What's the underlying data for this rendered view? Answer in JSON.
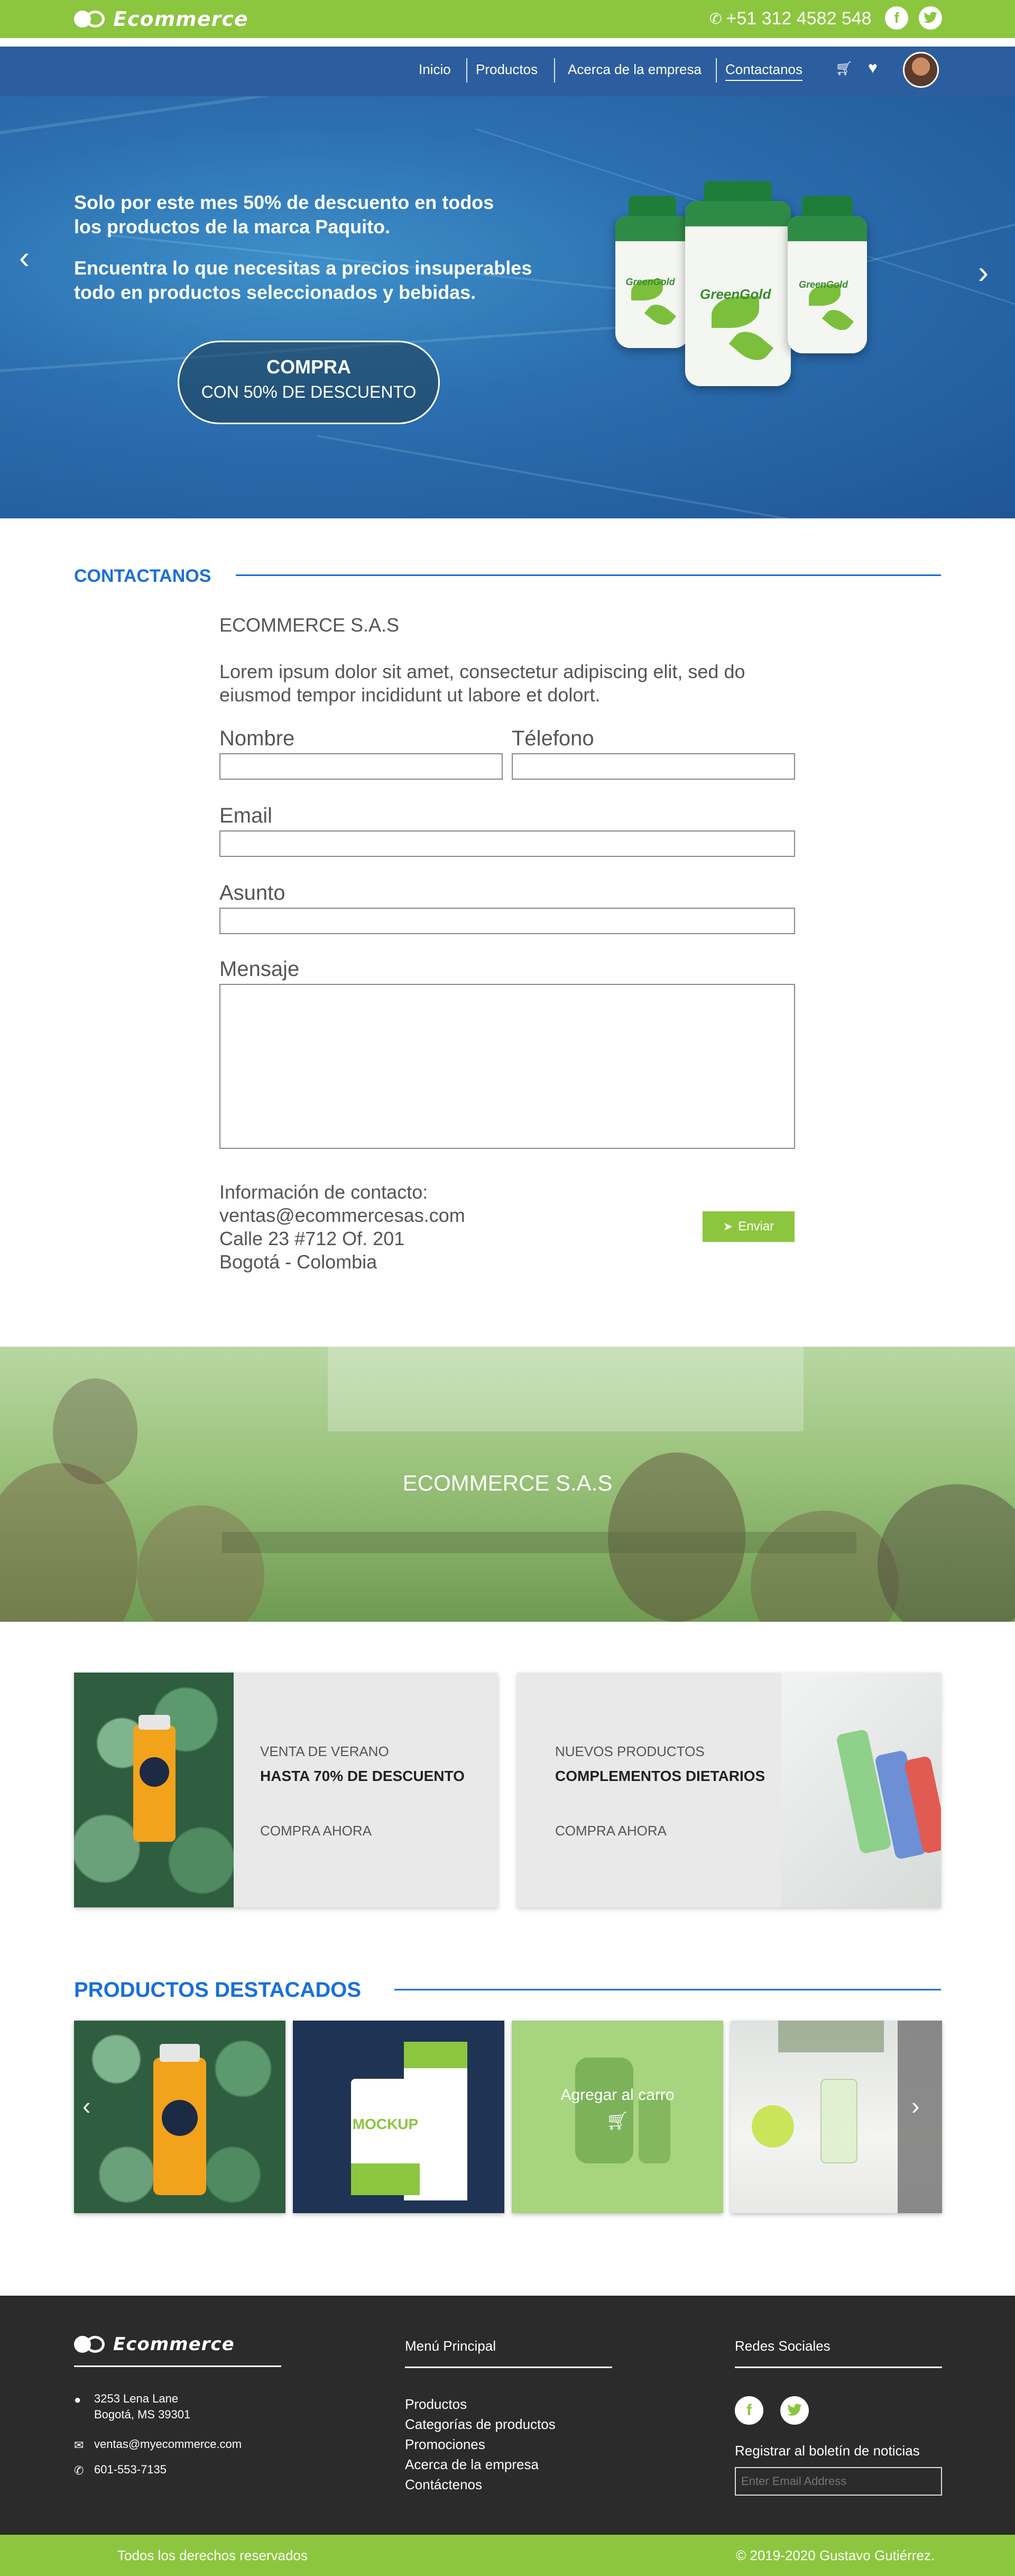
{
  "colors": {
    "brand_green": "#8cc63f",
    "nav_blue": "#2c5d9e",
    "accent_blue": "#1a6fdc",
    "footer_dark": "#2b2b2b"
  },
  "header": {
    "logo_text": "Ecommerce",
    "phone": "+51 312 4582 548",
    "social": [
      "facebook-icon",
      "twitter-icon"
    ]
  },
  "nav": {
    "items": [
      "Inicio",
      "Productos",
      "Acerca de la empresa",
      "Contactanos"
    ],
    "active": "Contactanos",
    "icons": [
      "cart-icon",
      "heart-icon",
      "avatar"
    ]
  },
  "hero": {
    "line1": "Solo por este mes 50% de descuento en todos",
    "line2": "los productos de la marca Paquito.",
    "line3": "Encuentra lo que necesitas a precios insuperables",
    "line4": "todo en productos seleccionados y bebidas.",
    "button_title": "COMPRA",
    "button_sub": "CON 50% DE DESCUENTO",
    "product_brand": "GreenGold"
  },
  "contact": {
    "section_title": "CONTACTANOS",
    "company": "ECOMMERCE S.A.S",
    "description_1": "Lorem ipsum dolor sit amet, consectetur adipiscing elit, sed do",
    "description_2": "eiusmod tempor incididunt ut labore et dolort.",
    "labels": {
      "name": "Nombre",
      "phone": "Télefono",
      "email": "Email",
      "subject": "Asunto",
      "message": "Mensaje"
    },
    "info_title": "Información de contacto:",
    "info_email": "ventas@ecommercesas.com",
    "info_address": "Calle 23 #712 Of. 201",
    "info_city": "Bogotá - Colombia",
    "send_label": "Enviar"
  },
  "banner": {
    "title": "ECOMMERCE S.A.S"
  },
  "promos": [
    {
      "small": "VENTA DE VERANO",
      "big": "HASTA 70% DE DESCUENTO",
      "link": "COMPRA AHORA"
    },
    {
      "small": "NUEVOS PRODUCTOS",
      "big": "COMPLEMENTOS DIETARIOS",
      "link": "COMPRA AHORA"
    }
  ],
  "featured": {
    "title": "PRODUCTOS DESTACADOS",
    "add_to_cart": "Agregar al carro",
    "mockup_text": "MOCKUP"
  },
  "footer": {
    "logo_text": "Ecommerce",
    "address_1": "3253 Lena Lane",
    "address_2": "Bogotá, MS 39301",
    "email": "ventas@myecommerce.com",
    "phone": "601-553-7135",
    "menu_title": "Menú Principal",
    "menu_items": [
      "Productos",
      "Categorías de productos",
      "Promociones",
      "Acerca de la empresa",
      "Contáctenos"
    ],
    "social_title": "Redes Sociales",
    "newsletter_label": "Registrar al boletín de noticias",
    "newsletter_placeholder": "Enter Email Address",
    "rights": "Todos los derechos reservados",
    "copyright": "© 2019-2020 Gustavo Gutiérrez."
  }
}
